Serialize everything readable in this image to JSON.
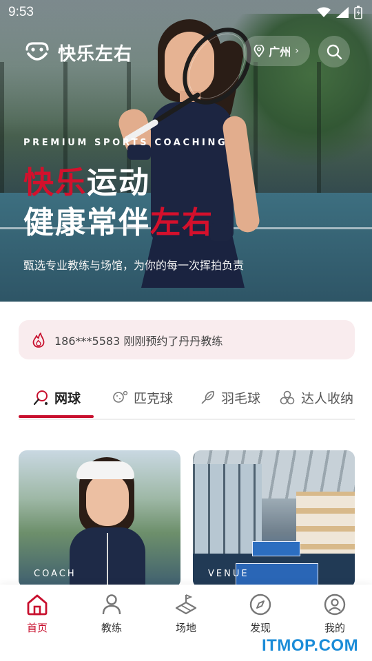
{
  "status_bar": {
    "time": "9:53",
    "icons": [
      "wifi-icon",
      "signal-icon",
      "battery-icon"
    ]
  },
  "header": {
    "brand": "快乐左右",
    "city": "广州",
    "logo_icon": "smiley-logo-icon"
  },
  "hero": {
    "subtitle": "PREMIUM SPORTS COACHING",
    "title_line1_red": "快乐",
    "title_line1_white": "运动",
    "title_line2_white": "健康常伴",
    "title_line2_red": "左右",
    "description": "甄选专业教练与场馆，为你的每一次挥拍负责"
  },
  "notice": {
    "text": "186***5583 刚刚预约了丹丹教练",
    "icon": "flame-icon"
  },
  "tabs": [
    {
      "label": "网球",
      "icon": "tennis-racket-icon",
      "active": true
    },
    {
      "label": "匹克球",
      "icon": "pickleball-icon",
      "active": false
    },
    {
      "label": "羽毛球",
      "icon": "badminton-icon",
      "active": false
    },
    {
      "label": "达人收纳",
      "icon": "grid-balls-icon",
      "active": false
    }
  ],
  "cards": [
    {
      "label": "COACH"
    },
    {
      "label": "VENUE"
    }
  ],
  "bottom_nav": [
    {
      "label": "首页",
      "icon": "home-icon",
      "active": true
    },
    {
      "label": "教练",
      "icon": "person-icon",
      "active": false
    },
    {
      "label": "场地",
      "icon": "court-icon",
      "active": false
    },
    {
      "label": "发现",
      "icon": "compass-icon",
      "active": false
    },
    {
      "label": "我的",
      "icon": "profile-icon",
      "active": false
    }
  ],
  "watermark": "ITMOP.COM",
  "colors": {
    "accent": "#c8102e",
    "notice_bg": "#f9ecee",
    "watermark": "#1b8cd8"
  }
}
